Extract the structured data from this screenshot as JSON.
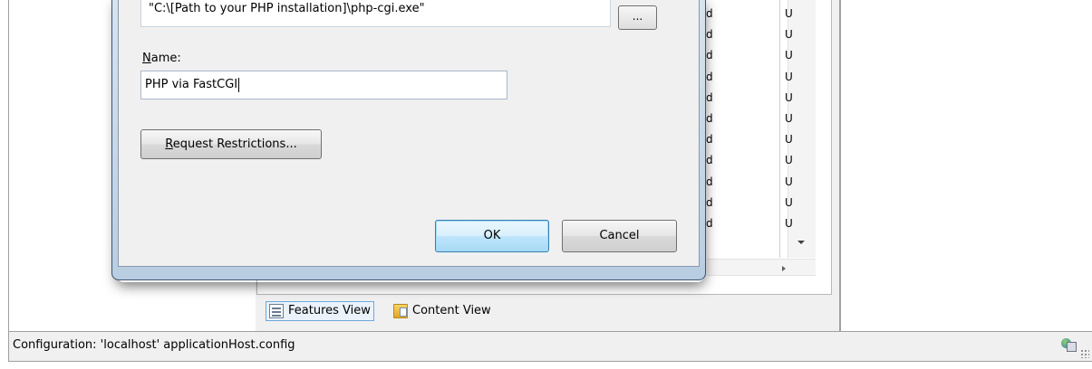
{
  "dialog": {
    "executable_value": "\"C:\\[Path to your PHP installation]\\php-cgi.exe\"",
    "browse_label": "...",
    "name_label_accel": "N",
    "name_label_rest": "ame:",
    "name_value": "PHP via FastCGI",
    "request_restrictions_accel": "R",
    "request_restrictions_rest": "equest Restrictions...",
    "ok_label": "OK",
    "cancel_label": "Cancel"
  },
  "list": {
    "column_fragment_d": [
      "d",
      "d",
      "d",
      "d",
      "d",
      "d",
      "d",
      "d",
      "d",
      "d",
      "d"
    ],
    "column_fragment_u": [
      "U",
      "U",
      "U",
      "U",
      "U",
      "U",
      "U",
      "U",
      "U",
      "U",
      "U"
    ]
  },
  "view_switcher": {
    "features_view": "Features View",
    "content_view": "Content View"
  },
  "statusbar": {
    "text": "Configuration: 'localhost' applicationHost.config"
  },
  "icons": {
    "features_view": "features-view-icon",
    "content_view": "content-view-icon",
    "status": "network-status-icon"
  }
}
